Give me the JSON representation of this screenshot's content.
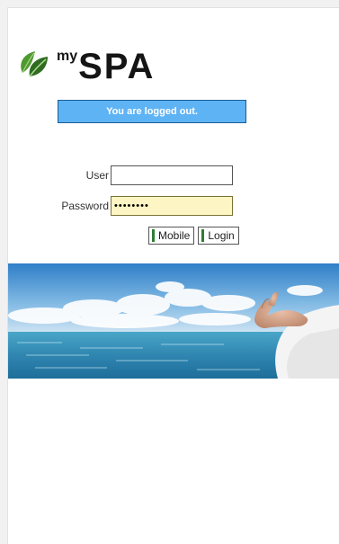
{
  "logo": {
    "prefix": "my",
    "name": "SPA",
    "icon": "leaf-icon"
  },
  "status": {
    "message": "You are logged out.",
    "background_color": "#5eb3f5"
  },
  "login_form": {
    "user_label": "User",
    "user_value": "",
    "password_label": "Password",
    "password_value": "••••••••"
  },
  "buttons": {
    "mobile_label": "Mobile",
    "login_label": "Login",
    "accent_color": "#2e7d32"
  },
  "banner": {
    "image": "sea-and-sky-meditation-banner"
  }
}
